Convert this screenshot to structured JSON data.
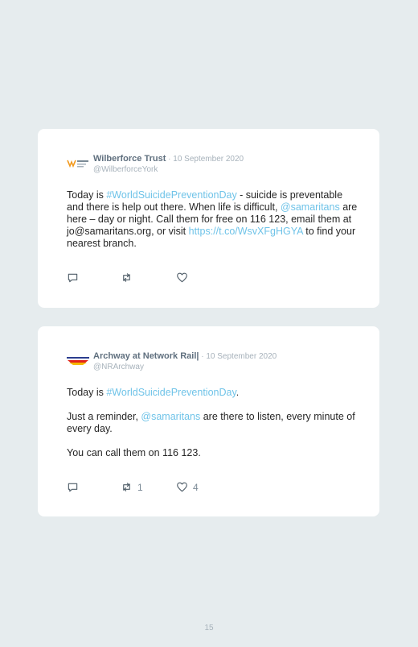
{
  "tweets": [
    {
      "author": "Wilberforce Trust",
      "date_sep": " · ",
      "date": "10 September 2020",
      "handle": "@WilberforceYork",
      "body": {
        "t1": "Today is ",
        "l1": "#WorldSuicidePreventionDay",
        "t2": " - suicide is preventable and there is help out there. When life is difficult, ",
        "l2": "@samaritans",
        "t3": " are here – day or night. Call them for free on 116 123, email them at jo@samaritans.org, or visit ",
        "l3": "https://t.co/WsvXFgHGYA",
        "t4": " to find your nearest branch."
      },
      "retweet_count": "",
      "like_count": ""
    },
    {
      "author": "Archway at Network Rail",
      "author_suffix": "|",
      "date_sep": " · ",
      "date": "10 September 2020",
      "handle": "@NRArchway",
      "body": {
        "p1_t1": "Today is ",
        "p1_l1": "#WorldSuicidePreventionDay",
        "p1_t2": ".",
        "p2_t1": "Just a reminder, ",
        "p2_l1": "@samaritans",
        "p2_t2": " are there to listen, every minute of every day.",
        "p3": "You can call them on 116 123."
      },
      "retweet_count": "1",
      "like_count": "4"
    }
  ],
  "icons": [
    "reply-icon",
    "retweet-icon",
    "like-icon"
  ],
  "colors": {
    "link": "#6fc3e8",
    "background": "#e6ecee",
    "card": "#ffffff"
  },
  "page_number": "15"
}
